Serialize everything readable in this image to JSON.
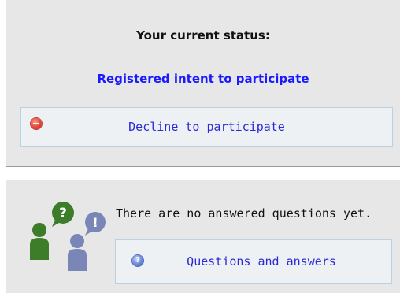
{
  "status": {
    "title": "Your current status:",
    "value": "Registered intent to participate"
  },
  "actions": {
    "decline_label": "Decline to participate",
    "decline_icon": "minus-circle-icon",
    "qa_label": "Questions and answers",
    "qa_icon": "help-circle-icon"
  },
  "questions": {
    "message": "There are no answered questions yet.",
    "illustration": "people-question-illustration",
    "bubble_marks": [
      "?",
      "!"
    ],
    "help_glyph": "?"
  },
  "colors": {
    "panel_background": "#e7e7e7",
    "status_value": "#1a1aff",
    "link": "#2929d6",
    "button_border": "#b7d3e2",
    "person_green": "#3d7d2a",
    "person_blue": "#7a87b6",
    "decline_icon": "#e2483a"
  }
}
